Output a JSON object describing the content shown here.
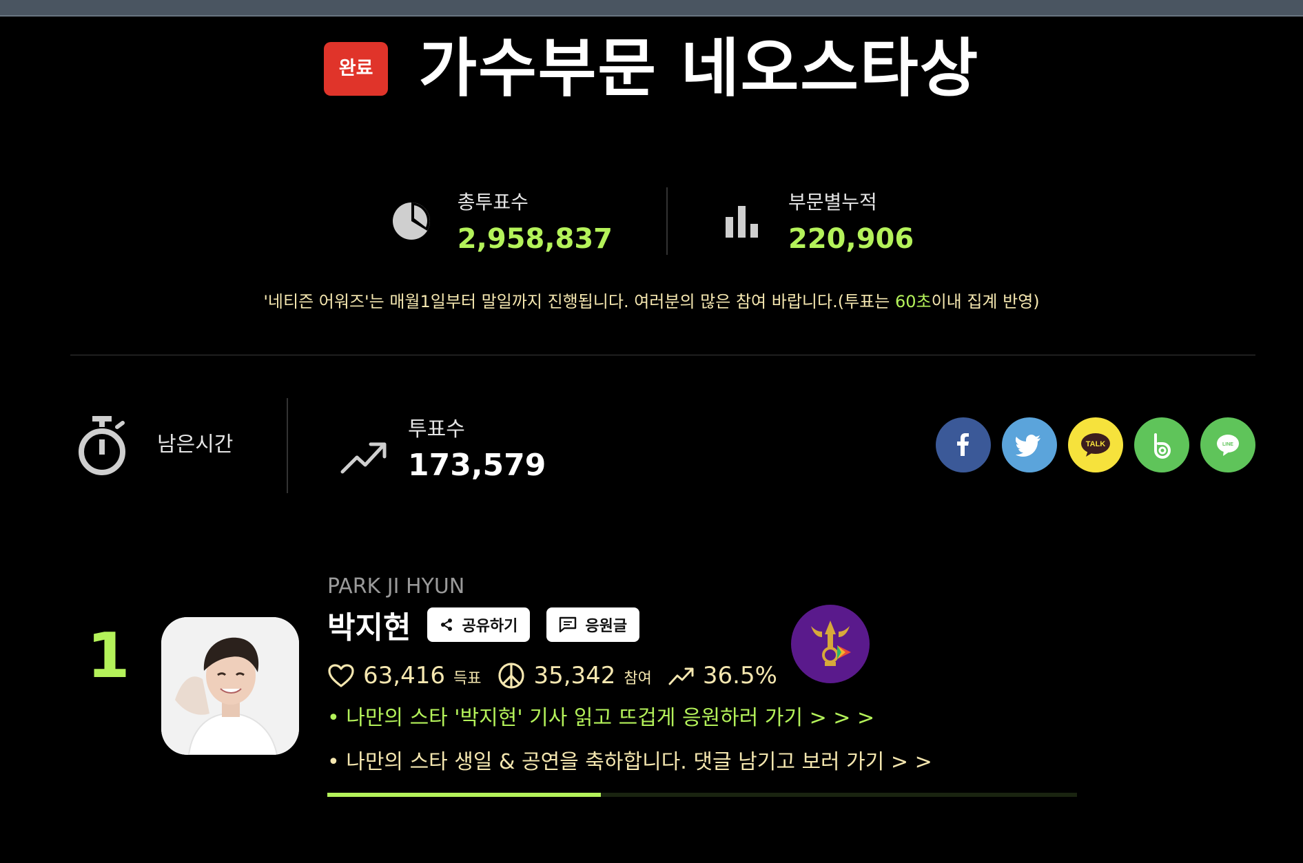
{
  "header": {
    "badge": "완료",
    "title": "가수부문 네오스타상"
  },
  "stats": [
    {
      "icon": "pie-chart-icon",
      "label": "총투표수",
      "value": "2,958,837"
    },
    {
      "icon": "bar-chart-icon",
      "label": "부문별누적",
      "value": "220,906"
    }
  ],
  "notice": {
    "before": "'네티즌 어워즈'는 매월1일부터 말일까지 진행됩니다. 여러분의 많은 참여 바랍니다.(투표는 ",
    "highlight": "60초",
    "after": "이내 집계 반영)"
  },
  "timer": {
    "label": "남은시간"
  },
  "votes": {
    "label": "투표수",
    "value": "173,579"
  },
  "social": [
    {
      "name": "facebook",
      "color": "#3b5998"
    },
    {
      "name": "twitter",
      "color": "#5ba4db"
    },
    {
      "name": "kakaotalk",
      "color": "#f6e23c",
      "text": "TALK"
    },
    {
      "name": "band",
      "color": "#5fc45a"
    },
    {
      "name": "line",
      "color": "#5fc45a",
      "text": "LINE"
    }
  ],
  "colors": {
    "accent": "#b4f25a",
    "badge": "#e0342a",
    "cream": "#f5e7b0"
  },
  "candidate": {
    "rank": "1",
    "name_en": "PARK JI HYUN",
    "name_kr": "박지현",
    "share_label": "공유하기",
    "cheer_label": "응원글",
    "votes": "63,416",
    "votes_unit": "득표",
    "participants": "35,342",
    "participants_unit": "참여",
    "percent": "36.5%",
    "percent_value": 36.5,
    "link1": "• 나만의 스타 '박지현' 기사 읽고 뜨겁게 응원하러 가기 > > >",
    "link2": "• 나만의 스타 생일 & 공연을 축하합니다. 댓글 남기고 보러 가기 > >"
  }
}
